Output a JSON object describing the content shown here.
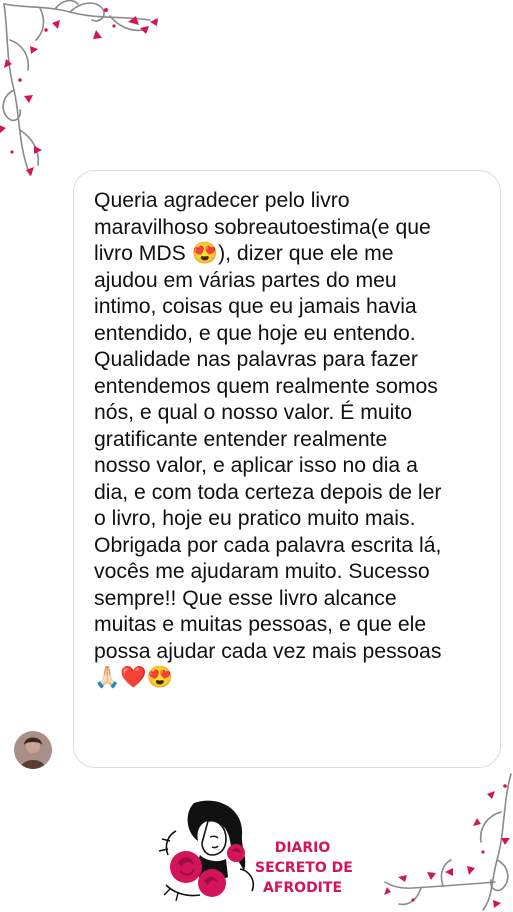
{
  "message": {
    "lines": [
      "Queria agradecer pelo livro",
      "maravilhoso sobreautoestima(e que",
      "livro MDS 😍), dizer que ele me",
      "ajudou em várias partes do meu",
      "intimo, coisas que eu jamais havia",
      "entendido, e que hoje eu entendo.",
      "Qualidade nas palavras para fazer",
      "entendemos quem realmente somos",
      "nós, e qual o nosso valor. É muito",
      "gratificante entender realmente",
      "nosso valor, e aplicar isso no dia a",
      "dia, e com toda certeza depois de ler",
      "o livro, hoje eu pratico muito mais.",
      "Obrigada por cada palavra escrita lá,",
      "vocês me ajudaram muito. Sucesso",
      "sempre!! Que esse livro alcance",
      "muitas e muitas pessoas, e que ele",
      "possa ajudar cada vez mais pessoas",
      "🙏🏻❤️😍"
    ]
  },
  "logo": {
    "line1": "DIARIO",
    "line2": "SECRETO DE",
    "line3": "AFRODITE"
  },
  "colors": {
    "accent": "#d4145a",
    "bubble_border": "#dcdcdc",
    "text": "#111111"
  },
  "icons": {
    "corner_top_left": "floral-ornament",
    "corner_bottom_right": "floral-ornament",
    "avatar": "user-avatar",
    "logo": "goddess-silhouette-with-roses"
  }
}
